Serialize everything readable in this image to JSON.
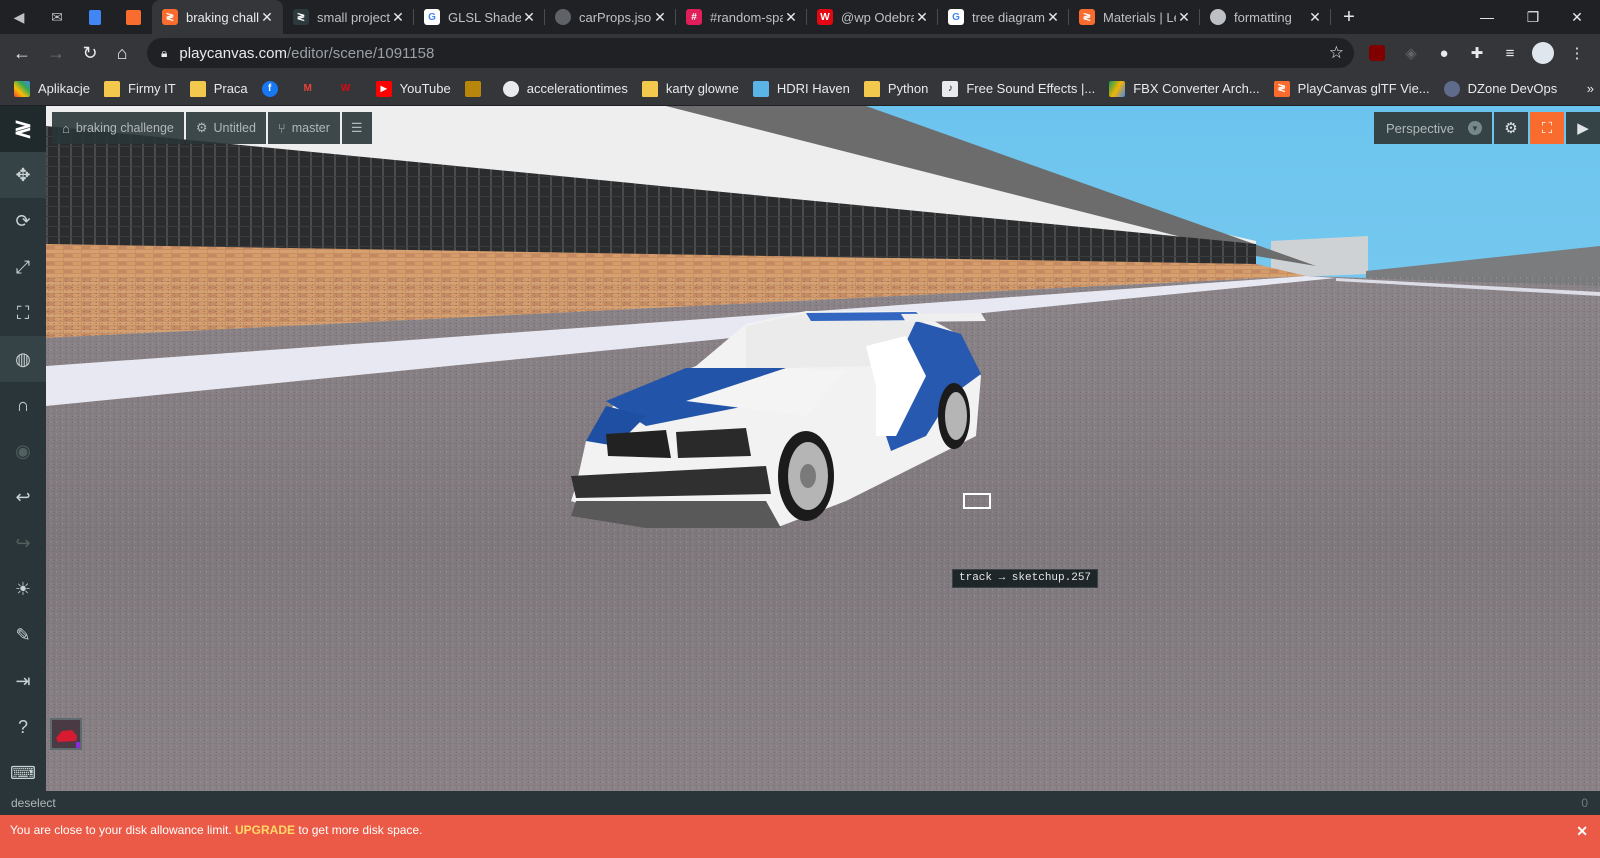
{
  "browser": {
    "tabs": [
      {
        "title": "braking challenge",
        "favicon": "playcanvas-icon",
        "color": "#f96c2e",
        "active": true
      },
      {
        "title": "small project",
        "favicon": "playcanvas-dark-icon",
        "color": "#2d3a3d",
        "active": false
      },
      {
        "title": "GLSL Shaders",
        "favicon": "google-icon",
        "color": "#ffffff",
        "active": false
      },
      {
        "title": "carProps.json",
        "favicon": "globe-icon",
        "color": "#5f6368",
        "active": false
      },
      {
        "title": "#random-spam",
        "favicon": "slack-icon",
        "color": "#e01e5a",
        "active": false
      },
      {
        "title": "@wp Odebrane",
        "favicon": "wp-icon",
        "color": "#e30613",
        "active": false
      },
      {
        "title": "tree diagram",
        "favicon": "google-icon",
        "color": "#ffffff",
        "active": false
      },
      {
        "title": "Materials | Learn",
        "favicon": "playcanvas-icon",
        "color": "#f96c2e",
        "active": false
      },
      {
        "title": "formatting",
        "favicon": "cloud-icon",
        "color": "#bdc1c6",
        "active": false
      }
    ],
    "url_host": "playcanvas.com",
    "url_path": "/editor/scene/1091158",
    "bookmarks": [
      {
        "label": "Aplikacje",
        "icon": "apps-grid-icon"
      },
      {
        "label": "Firmy IT",
        "icon": "folder-icon"
      },
      {
        "label": "Praca",
        "icon": "folder-icon"
      },
      {
        "label": "",
        "icon": "facebook-icon"
      },
      {
        "label": "",
        "icon": "gmail-icon"
      },
      {
        "label": "",
        "icon": "wp-icon"
      },
      {
        "label": "YouTube",
        "icon": "youtube-icon"
      },
      {
        "label": "",
        "icon": "image-icon"
      },
      {
        "label": "accelerationtimes",
        "icon": "globe-icon"
      },
      {
        "label": "karty glowne",
        "icon": "folder-icon"
      },
      {
        "label": "HDRI Haven",
        "icon": "hdri-icon"
      },
      {
        "label": "Python",
        "icon": "folder-icon"
      },
      {
        "label": "Free Sound Effects |...",
        "icon": "sound-icon"
      },
      {
        "label": "FBX Converter Arch...",
        "icon": "drive-icon"
      },
      {
        "label": "PlayCanvas glTF Vie...",
        "icon": "playcanvas-icon"
      },
      {
        "label": "DZone DevOps",
        "icon": "dzone-icon"
      }
    ],
    "bookmarks_overflow": "»"
  },
  "editor": {
    "project_name": "braking challenge",
    "scene_name": "Untitled",
    "branch": "master",
    "camera_label": "Perspective",
    "tooltip": "track → sketchup.257",
    "status_text": "deselect",
    "status_count": "0",
    "warning": {
      "pre": "You are close to your disk allowance limit.",
      "link": "UPGRADE",
      "post": "to get more disk space."
    },
    "tools": [
      "translate",
      "rotate",
      "scale",
      "resize",
      "world-space",
      "snap",
      "camera-focus",
      "undo",
      "redo",
      "lightmapper",
      "code-editor",
      "publish",
      "help",
      "keyboard"
    ]
  }
}
